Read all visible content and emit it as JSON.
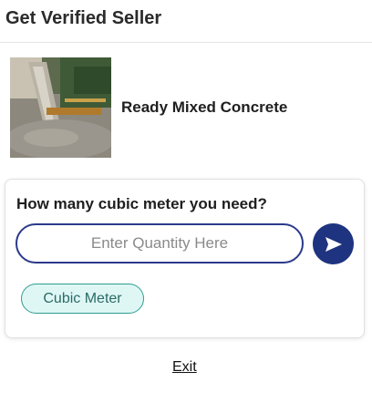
{
  "header": {
    "title": "Get Verified Seller"
  },
  "product": {
    "name": "Ready Mixed Concrete",
    "image_icon": "concrete-pour-photo"
  },
  "card": {
    "question": "How many cubic meter you need?",
    "quantity_input": {
      "value": "",
      "placeholder": "Enter Quantity Here"
    },
    "send_icon": "send-arrow-icon",
    "unit_option": "Cubic Meter"
  },
  "footer": {
    "exit_label": "Exit"
  },
  "colors": {
    "accent_navy": "#1f3480",
    "input_border": "#2b3a8c",
    "chip_border": "#2f9e8f",
    "chip_bg": "#def7f5"
  }
}
